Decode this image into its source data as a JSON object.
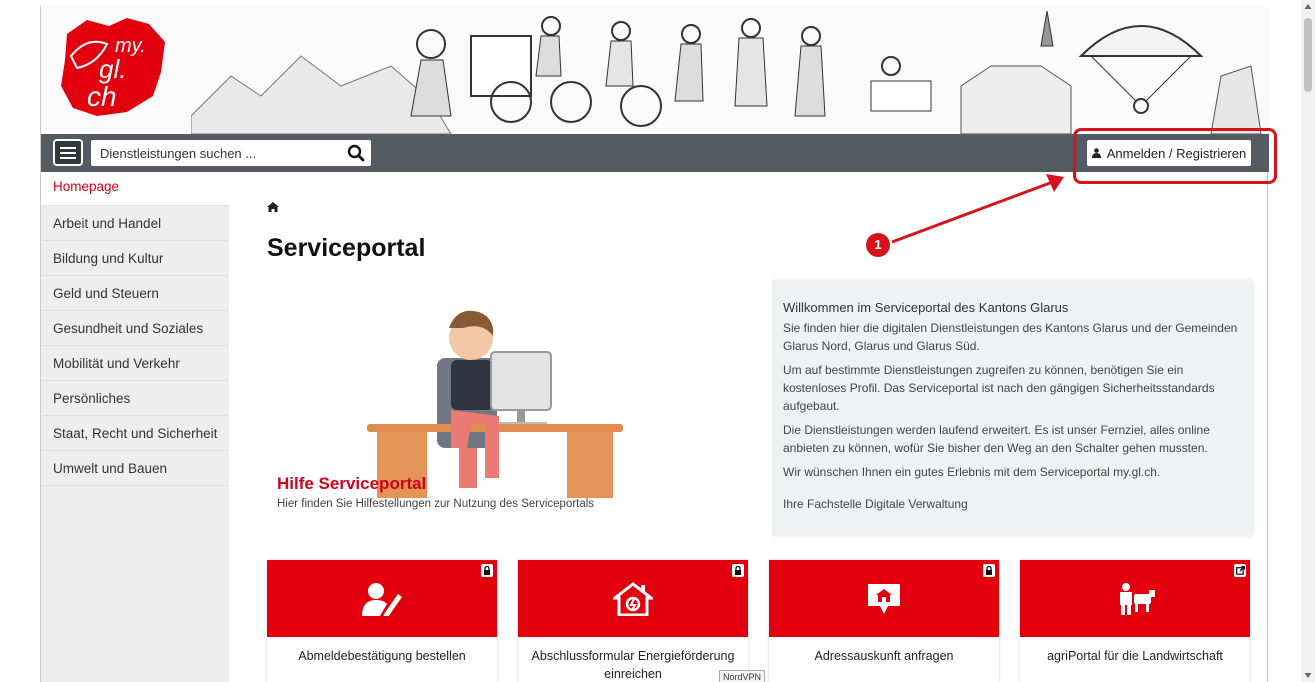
{
  "brand": {
    "logo_text_1": "my.",
    "logo_text_2": "gl.",
    "logo_text_3": "ch"
  },
  "toolbar": {
    "search_placeholder": "Dienstleistungen suchen ...",
    "login_label": "Anmelden / Registrieren"
  },
  "sidebar": {
    "items": [
      {
        "label": "Homepage"
      },
      {
        "label": "Arbeit und Handel"
      },
      {
        "label": "Bildung und Kultur"
      },
      {
        "label": "Geld und Steuern"
      },
      {
        "label": "Gesundheit und Soziales"
      },
      {
        "label": "Mobilität und Verkehr"
      },
      {
        "label": "Persönliches"
      },
      {
        "label": "Staat, Recht und Sicherheit"
      },
      {
        "label": "Umwelt und Bauen"
      }
    ]
  },
  "main": {
    "title": "Serviceportal",
    "help": {
      "title": "Hilfe Serviceportal",
      "subtitle": "Hier finden Sie Hilfestellungen zur Nutzung des Serviceportals"
    },
    "welcome": {
      "title": "Willkommen im Serviceportal des Kantons Glarus",
      "p1": "Sie finden hier die digitalen Dienstleistungen des Kantons Glarus und der Gemeinden Glarus Nord, Glarus und Glarus Süd.",
      "p2": "Um auf bestimmte Dienstleistungen zugreifen zu können, benötigen Sie ein kostenloses Profil. Das Serviceportal ist nach den gängigen Sicherheitsstandards aufgebaut.",
      "p3": "Die Dienstleistungen werden laufend erweitert. Es ist unser Fernziel, alles online anbieten zu können, wofür Sie bisher den Weg an den Schalter gehen mussten.",
      "p4": "Wir wünschen Ihnen ein gutes Erlebnis mit dem Serviceportal my.gl.ch.",
      "signature": "Ihre Fachstelle Digitale Verwaltung"
    },
    "tiles": [
      {
        "label": "Abmeldebestätigung bestellen",
        "icon": "user-edit-icon",
        "corner": "lock-icon"
      },
      {
        "label": "Abschlussformular Energieförderung einreichen",
        "icon": "energy-house-icon",
        "corner": "lock-icon"
      },
      {
        "label": "Adressauskunft anfragen",
        "icon": "address-bubble-icon",
        "corner": "lock-icon"
      },
      {
        "label": "agriPortal für die Landwirtschaft",
        "icon": "farmer-cow-icon",
        "corner": "external-link-icon"
      }
    ]
  },
  "annotation": {
    "step_number": "1"
  },
  "tooltip": "NordVPN",
  "colors": {
    "brand_red": "#e2000f",
    "toolbar": "#545b62",
    "sidebar": "#eeeeee",
    "annotation": "#d8121b"
  }
}
